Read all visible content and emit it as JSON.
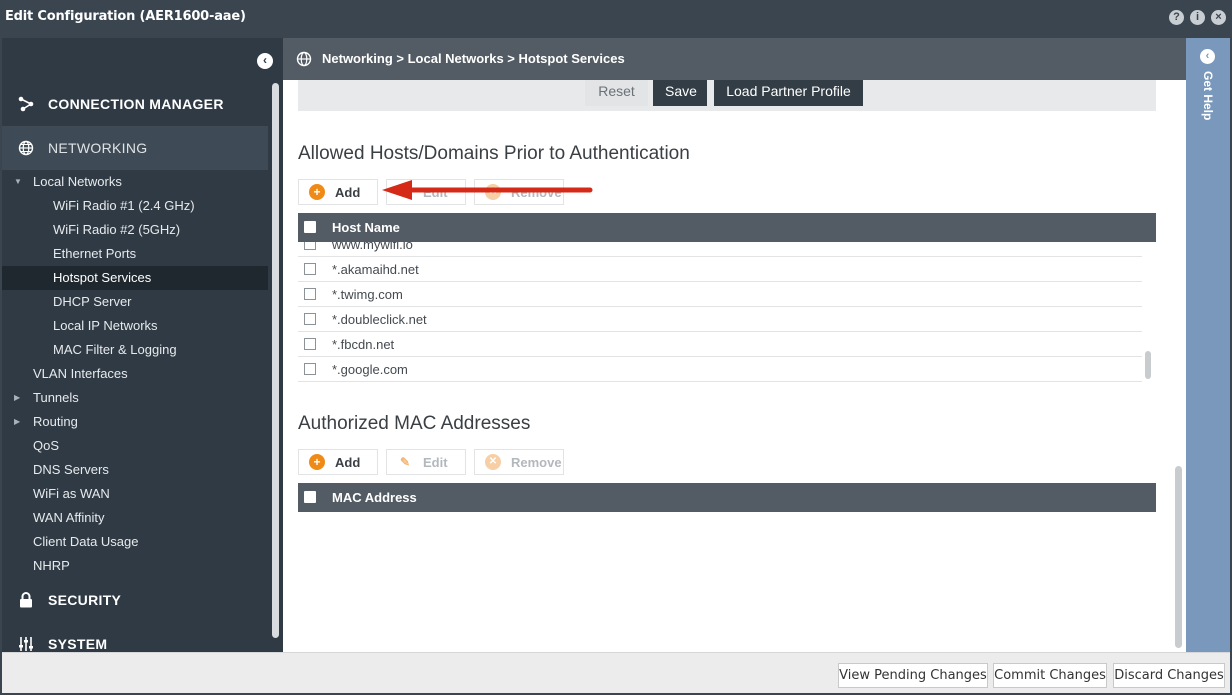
{
  "window": {
    "title": "Edit Configuration (AER1600-aae)",
    "help_glyph": "?",
    "info_glyph": "i",
    "close_glyph": "×"
  },
  "sidebar": {
    "collapse_glyph": "‹",
    "sections": {
      "connection_manager": "CONNECTION MANAGER",
      "networking": "NETWORKING",
      "security": "SECURITY",
      "system": "SYSTEM"
    },
    "items": {
      "local_networks": "Local Networks",
      "wifi1": "WiFi Radio #1 (2.4 GHz)",
      "wifi2": "WiFi Radio #2 (5GHz)",
      "ethernet": "Ethernet Ports",
      "hotspot": "Hotspot Services",
      "dhcp": "DHCP Server",
      "local_ip": "Local IP Networks",
      "mac_filter": "MAC Filter & Logging",
      "vlan": "VLAN Interfaces",
      "tunnels": "Tunnels",
      "routing": "Routing",
      "qos": "QoS",
      "dns": "DNS Servers",
      "wifi_wan": "WiFi as WAN",
      "wan_affinity": "WAN Affinity",
      "client_data": "Client Data Usage",
      "nhrp": "NHRP"
    }
  },
  "header": {
    "breadcrumb": "Networking > Local Networks > Hotspot Services"
  },
  "help": {
    "label": "Get Help",
    "toggle_glyph": "‹"
  },
  "toolbar": {
    "reset": "Reset",
    "save": "Save",
    "load_partner": "Load Partner Profile"
  },
  "allowed_hosts": {
    "title": "Allowed Hosts/Domains Prior to Authentication",
    "add": "Add",
    "edit": "Edit",
    "remove": "Remove",
    "column": "Host Name",
    "rows": [
      "www.mywifi.io",
      "*.akamaihd.net",
      "*.twimg.com",
      "*.doubleclick.net",
      "*.fbcdn.net",
      "*.google.com"
    ]
  },
  "mac_addresses": {
    "title": "Authorized MAC Addresses",
    "add": "Add",
    "edit": "Edit",
    "remove": "Remove",
    "column": "MAC Address"
  },
  "footer": {
    "view_pending": "View Pending Changes",
    "commit": "Commit Changes",
    "discard": "Discard Changes"
  },
  "colors": {
    "accent_orange": "#f08a17",
    "arrow_red": "#d42a17",
    "sidebar_bg": "#2f3a44",
    "help_rail": "#7a98bc"
  }
}
